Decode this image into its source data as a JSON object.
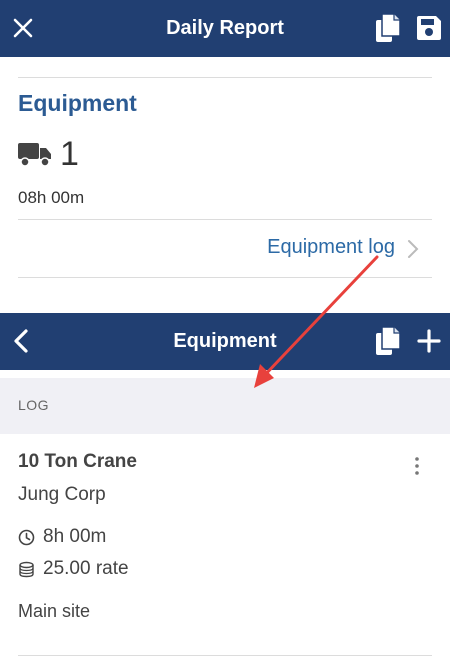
{
  "topbar": {
    "title": "Daily Report",
    "close_icon": "close-icon",
    "copy_icon": "copy-icon",
    "save_icon": "save-icon"
  },
  "summary": {
    "title": "Equipment",
    "count": "1",
    "hours": "08h 00m",
    "log_link": "Equipment log"
  },
  "subbar": {
    "title": "Equipment",
    "back_icon": "chevron-left-icon",
    "copy_icon": "copy-icon",
    "add_icon": "plus-icon"
  },
  "log": {
    "header": "LOG",
    "entries": [
      {
        "name": "10 Ton Crane",
        "company": "Jung Corp",
        "time": "8h 00m",
        "rate": "25.00 rate",
        "site": "Main site"
      }
    ]
  },
  "colors": {
    "navbar": "#213f72",
    "accent": "#2c5b93",
    "link": "#2c6aa6",
    "annotation_arrow": "#e8413c"
  }
}
